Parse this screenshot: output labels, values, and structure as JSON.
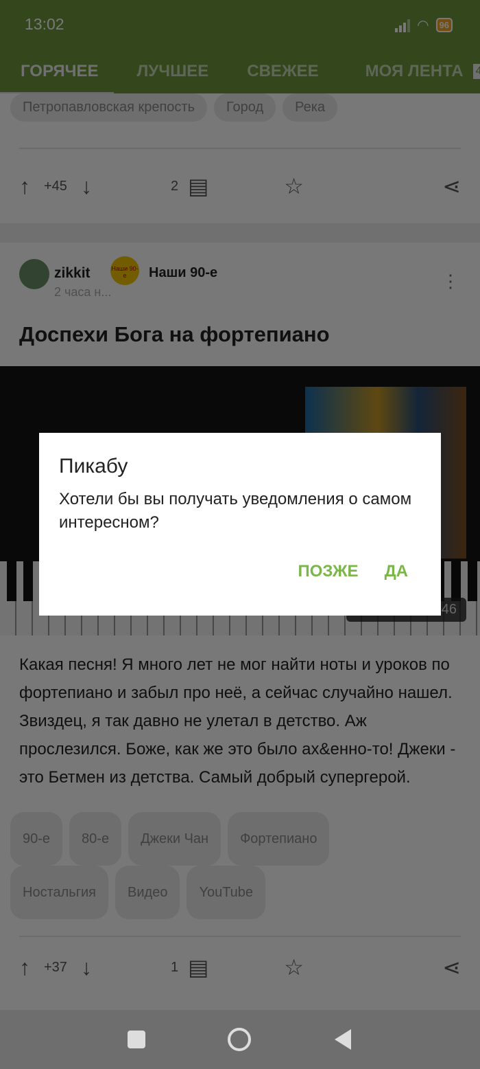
{
  "status_bar": {
    "time": "13:02",
    "battery": "96",
    "icons": [
      "signal-icon",
      "wifi-icon",
      "battery-icon"
    ]
  },
  "tabs": [
    {
      "label": "Горячее",
      "active": true
    },
    {
      "label": "Лучшее"
    },
    {
      "label": "Свежее"
    },
    {
      "label": "Моя лента",
      "badge": "45"
    }
  ],
  "prev_post": {
    "tags": [
      "Петропавловская крепость",
      "Город",
      "Река"
    ],
    "rating": "+45",
    "comments": "2"
  },
  "post": {
    "author": "zikkit",
    "time": "2 часа н...",
    "community": "Наши 90-е",
    "community_logo_text": "Наши 90-е",
    "title": "Доспехи Бога на фортепиано",
    "video": {
      "source": "YouTube",
      "duration": "02:46",
      "label": "YouTube • 02:46"
    },
    "text": "Какая песня! Я много лет не мог найти ноты и уроков по фортепиано и забыл про неё, а сейчас случайно нашел. Звиздец, я так давно не улетал в детство. Аж прослезился. Боже, как же это было ах&енно-то! Джеки - это Бетмен из детства. Самый добрый супергерой.",
    "tags": [
      "90-е",
      "80-е",
      "Джеки Чан",
      "Фортепиано",
      "Ностальгия",
      "Видео",
      "YouTube"
    ],
    "rating": "+37",
    "comments": "1"
  },
  "dialog": {
    "title": "Пикабу",
    "message": "Хотели бы вы получать уведомления о самом интересном?",
    "later": "ПОЗЖЕ",
    "yes": "ДА"
  },
  "colors": {
    "header": "#6d963c",
    "accent": "#7ab648"
  }
}
